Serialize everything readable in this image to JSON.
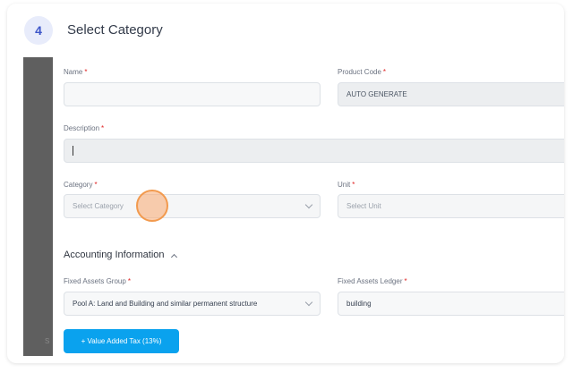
{
  "step": {
    "number": "4",
    "title": "Select Category"
  },
  "form": {
    "name": {
      "label": "Name",
      "required": "*",
      "value": ""
    },
    "product_code": {
      "label": "Product Code",
      "required": "*",
      "value": "AUTO GENERATE"
    },
    "description": {
      "label": "Description",
      "required": "*",
      "value": ""
    },
    "category": {
      "label": "Category",
      "required": "*",
      "placeholder": "Select Category"
    },
    "unit": {
      "label": "Unit",
      "required": "*",
      "placeholder": "Select Unit"
    },
    "accounting_section": {
      "title": "Accounting Information"
    },
    "fixed_assets_group": {
      "label": "Fixed Assets Group",
      "required": "*",
      "value": "Pool A: Land and Building and similar permanent structure"
    },
    "fixed_assets_ledger": {
      "label": "Fixed Assets Ledger",
      "required": "*",
      "value": "building"
    },
    "vat_button": {
      "label": "+ Value Added Tax (13%)"
    }
  },
  "sidebar": {
    "truncated_text": "S"
  },
  "colors": {
    "accent": "#0aa2ee",
    "required": "#e02424",
    "badge_bg": "#e8ecfb",
    "badge_text": "#3d56c9",
    "click_marker": "#f29a4e"
  }
}
